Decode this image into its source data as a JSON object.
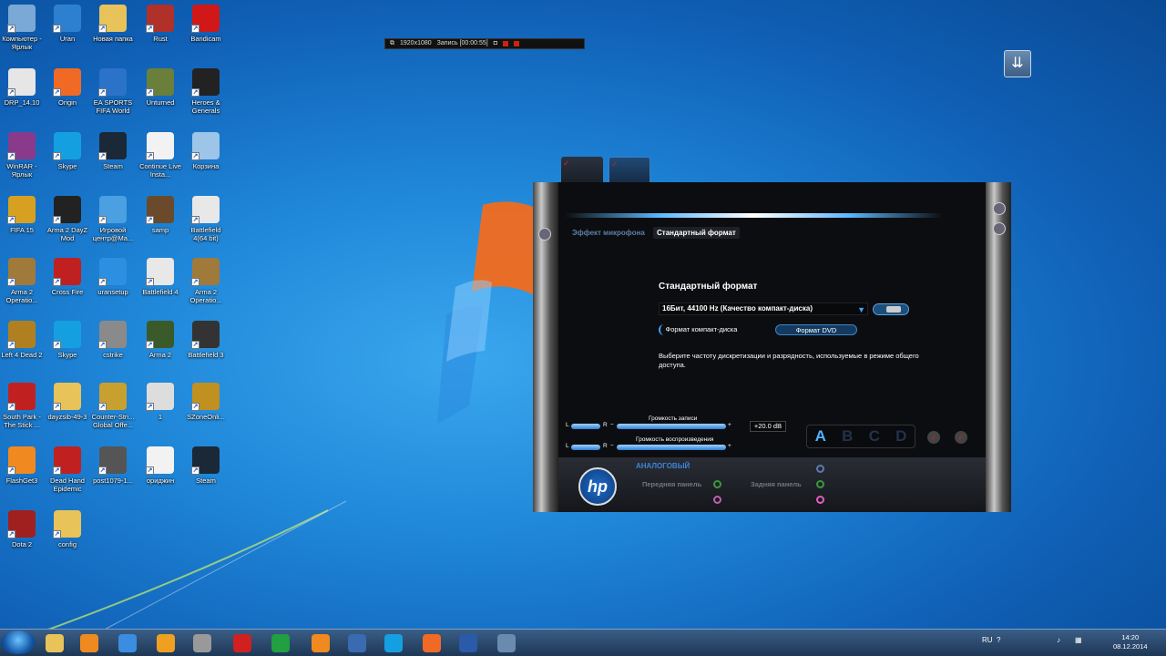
{
  "desktop_icons": [
    {
      "label": "Компьютер - Ярлык",
      "icon": "computer-icon",
      "color": "#7aa9d6"
    },
    {
      "label": "Uran",
      "icon": "uran-icon",
      "color": "#2d7fd0"
    },
    {
      "label": "Новая папка",
      "icon": "folder-icon",
      "color": "#e7c35a"
    },
    {
      "label": "Rust",
      "icon": "rust-icon",
      "color": "#b0302a"
    },
    {
      "label": "Bandicam",
      "icon": "bandicam-icon",
      "color": "#d01818"
    },
    {
      "label": "DRP_14.10",
      "icon": "disc-icon",
      "color": "#e6e6e6"
    },
    {
      "label": "Origin",
      "icon": "origin-icon",
      "color": "#f06a25"
    },
    {
      "label": "EA SPORTS FIFA World",
      "icon": "fifa-icon",
      "color": "#2a73c8"
    },
    {
      "label": "Unturned",
      "icon": "unturned-icon",
      "color": "#6a7f3a"
    },
    {
      "label": "Heroes & Generals",
      "icon": "hg-icon",
      "color": "#222222"
    },
    {
      "label": "WinRAR - Ярлык",
      "icon": "winrar-icon",
      "color": "#8a3a8a"
    },
    {
      "label": "Skype",
      "icon": "skype-icon",
      "color": "#14a0e0"
    },
    {
      "label": "Steam",
      "icon": "steam-icon",
      "color": "#1b2838"
    },
    {
      "label": "Continue Live Insta...",
      "icon": "file-icon",
      "color": "#f2f2f2"
    },
    {
      "label": "Корзина",
      "icon": "recycle-bin-icon",
      "color": "#9cc5e8"
    },
    {
      "label": "FIFA 15",
      "icon": "fifa15-icon",
      "color": "#d8a020"
    },
    {
      "label": "Arma 2 DayZ Mod",
      "icon": "dayz-icon",
      "color": "#222222"
    },
    {
      "label": "Игровой центр@Ma...",
      "icon": "game-center-icon",
      "color": "#4aa0e0"
    },
    {
      "label": "samp",
      "icon": "samp-icon",
      "color": "#6a4a2a"
    },
    {
      "label": "Battlefield 4(64 bit)",
      "icon": "battlefield-icon",
      "color": "#e8e8e8"
    },
    {
      "label": "Arma 2 Operatio...",
      "icon": "arma-icon",
      "color": "#a07a3a"
    },
    {
      "label": "Cross Fire",
      "icon": "crossfire-icon",
      "color": "#c02020"
    },
    {
      "label": "uransetup",
      "icon": "setup-icon",
      "color": "#2d8fe0"
    },
    {
      "label": "Battlefield 4",
      "icon": "battlefield-icon",
      "color": "#e8e8e8"
    },
    {
      "label": "Arma 2 Operatio...",
      "icon": "arma-icon",
      "color": "#a07a3a"
    },
    {
      "label": "Left 4 Dead 2",
      "icon": "l4d2-icon",
      "color": "#b08020"
    },
    {
      "label": "Skype",
      "icon": "skype-icon",
      "color": "#14a0e0"
    },
    {
      "label": "cstrike",
      "icon": "cstrike-icon",
      "color": "#8a8a8a"
    },
    {
      "label": "Arma 2",
      "icon": "arma-icon",
      "color": "#3a5a2a"
    },
    {
      "label": "Battlefield 3",
      "icon": "bf3-icon",
      "color": "#333333"
    },
    {
      "label": "South Park - The Stick ...",
      "icon": "southpark-icon",
      "color": "#c02020"
    },
    {
      "label": "dayzsib-49-3",
      "icon": "folder-icon",
      "color": "#e7c35a"
    },
    {
      "label": "Counter-Stri... Global Offe...",
      "icon": "csgo-icon",
      "color": "#c8a030"
    },
    {
      "label": "1",
      "icon": "image-icon",
      "color": "#dddddd"
    },
    {
      "label": "SZoneOnli...",
      "icon": "szone-icon",
      "color": "#c09020"
    },
    {
      "label": "FlashGet3",
      "icon": "flashget-icon",
      "color": "#f08a20"
    },
    {
      "label": "Dead Hand Epidemic",
      "icon": "deadhand-icon",
      "color": "#c02020"
    },
    {
      "label": "post1079-1...",
      "icon": "image-icon",
      "color": "#555555"
    },
    {
      "label": "ориджин",
      "icon": "file-icon",
      "color": "#f2f2f2"
    },
    {
      "label": "Steam",
      "icon": "steam-icon",
      "color": "#1b2838"
    },
    {
      "label": "Dota 2",
      "icon": "dota-icon",
      "color": "#a02020"
    },
    {
      "label": "config",
      "icon": "folder-icon",
      "color": "#e7c35a"
    }
  ],
  "recbar": {
    "resolution": "1920x1080",
    "recording": "Запись [00:00:55]"
  },
  "hp_window": {
    "tab_inactive": "Эффект микрофона",
    "tab_active": "Стандартный формат",
    "heading": "Стандартный формат",
    "dropdown_value": "16Бит, 44100 Hz (Качество компакт-диска)",
    "pill_cd": "Формат компакт-диска",
    "pill_dvd": "Формат DVD",
    "description": "Выберите частоту дискретизации и разрядность, используемые в режиме общего доступа.",
    "rec_volume_label": "Громкость записи",
    "play_volume_label": "Громкость воспроизведения",
    "gain_value": "+20.0 dB",
    "letters": [
      "A",
      "B",
      "C",
      "D"
    ],
    "analog_label": "АНАЛОГОВЫЙ",
    "front_panel": "Передняя панель",
    "rear_panel": "Задняя панель",
    "logo": "hp",
    "slider_l": "L",
    "slider_r": "R",
    "slider_minus": "−",
    "slider_plus": "+"
  },
  "taskbar": {
    "items": [
      "explorer-icon",
      "media-player-icon",
      "chrome-icon",
      "mail-agent-icon",
      "gamepad-icon",
      "opera-icon",
      "green-a-icon",
      "odnoklassniki-icon",
      "vk-icon",
      "skype-icon",
      "origin-icon",
      "hp-audio-icon",
      "network-icon"
    ],
    "lang": "RU",
    "time": "14:20",
    "date": "08.12.2014"
  }
}
